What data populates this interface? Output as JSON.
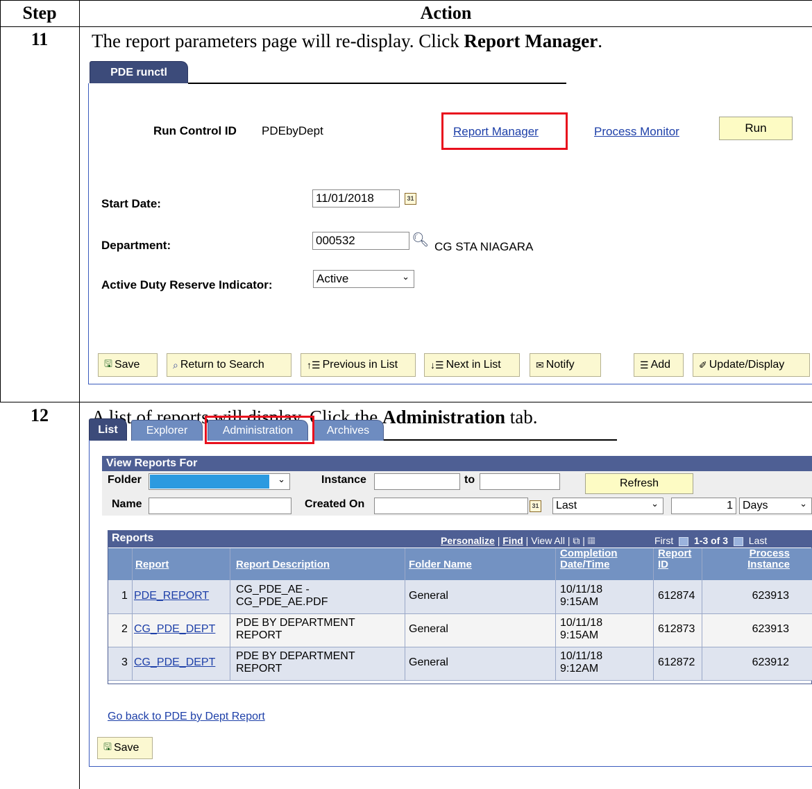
{
  "table": {
    "header_step": "Step",
    "header_action": "Action"
  },
  "steps": [
    {
      "number": "11",
      "instruction_pre": "The report parameters page will re-display.  Click ",
      "instruction_bold": "Report Manager",
      "instruction_post": "."
    },
    {
      "number": "12",
      "instruction_pre": "A list of reports will display.  Click the ",
      "instruction_bold": "Administration",
      "instruction_post": " tab."
    }
  ],
  "screen1": {
    "tab_label": "PDE runctl",
    "run_control_label": "Run Control ID",
    "run_control_value": "PDEbyDept",
    "report_manager_link": "Report Manager",
    "process_monitor_link": "Process Monitor",
    "run_button": "Run",
    "start_date_label": "Start Date:",
    "start_date_value": "11/01/2018",
    "department_label": "Department:",
    "department_value": "000532",
    "department_desc": "CG STA NIAGARA",
    "adri_label": "Active Duty Reserve Indicator:",
    "adri_value": "Active",
    "toolbar": {
      "save": "Save",
      "return_to_search": "Return to Search",
      "previous_in_list": "Previous in List",
      "next_in_list": "Next in List",
      "notify": "Notify",
      "add": "Add",
      "update_display": "Update/Display"
    }
  },
  "screen2": {
    "tabs": [
      "List",
      "Explorer",
      "Administration",
      "Archives"
    ],
    "view_reports_for": "View Reports For",
    "folder_label": "Folder",
    "instance_label": "Instance",
    "to_label": "to",
    "refresh_button": "Refresh",
    "name_label": "Name",
    "created_on_label": "Created On",
    "last_value": "Last",
    "days_number": "1",
    "days_value": "Days",
    "reports_title": "Reports",
    "personalize": "Personalize",
    "find": "Find",
    "view_all": "View All",
    "first": "First",
    "range": "1-3 of 3",
    "last_nav": "Last",
    "columns": {
      "report": "Report",
      "report_description": "Report Description",
      "folder_name": "Folder Name",
      "completion_1": "Completion",
      "completion_2": "Date/Time",
      "report_id_1": "Report",
      "report_id_2": "ID",
      "process_1": "Process",
      "process_2": "Instance"
    },
    "rows": [
      {
        "num": "1",
        "report": "PDE_REPORT",
        "desc1": "CG_PDE_AE -",
        "desc2": "CG_PDE_AE.PDF",
        "folder": "General",
        "date1": "10/11/18",
        "date2": "9:15AM",
        "report_id": "612874",
        "instance": "623913"
      },
      {
        "num": "2",
        "report": "CG_PDE_DEPT",
        "desc1": "PDE BY DEPARTMENT",
        "desc2": "REPORT",
        "folder": "General",
        "date1": "10/11/18",
        "date2": "9:15AM",
        "report_id": "612873",
        "instance": "623913"
      },
      {
        "num": "3",
        "report": "CG_PDE_DEPT",
        "desc1": "PDE BY DEPARTMENT",
        "desc2": "REPORT",
        "folder": "General",
        "date1": "10/11/18",
        "date2": "9:12AM",
        "report_id": "612872",
        "instance": "623912"
      }
    ],
    "go_back_link": "Go back to PDE by Dept Report",
    "save_button": "Save"
  }
}
